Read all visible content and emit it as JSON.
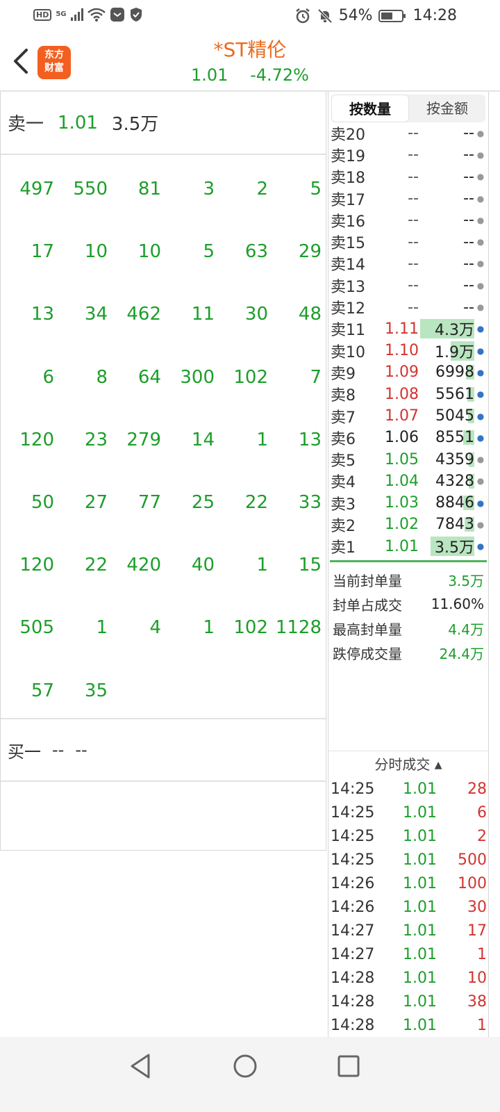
{
  "status_bar": {
    "network": "5G",
    "battery": "54%",
    "battery_level": 0.54,
    "time": "14:28",
    "icons": [
      "hd-icon",
      "signal-icon",
      "wifi-icon",
      "app-notification-icon",
      "shield-icon",
      "alarm-icon",
      "mute-icon",
      "battery-icon"
    ]
  },
  "header": {
    "logo_text": "东方财富",
    "logo_line1": "东方",
    "logo_line2": "财富",
    "title": "*ST精伦",
    "price": "1.01",
    "change": "-4.72%"
  },
  "left": {
    "sell1_label": "卖一",
    "sell1_price": "1.01",
    "sell1_volume": "3.5万",
    "queue": [
      [
        "497",
        "550",
        "81",
        "3",
        "2",
        "5"
      ],
      [
        "17",
        "10",
        "10",
        "5",
        "63",
        "29"
      ],
      [
        "13",
        "34",
        "462",
        "11",
        "30",
        "48"
      ],
      [
        "6",
        "8",
        "64",
        "300",
        "102",
        "7"
      ],
      [
        "120",
        "23",
        "279",
        "14",
        "1",
        "13"
      ],
      [
        "50",
        "27",
        "77",
        "25",
        "22",
        "33"
      ],
      [
        "120",
        "22",
        "420",
        "40",
        "1",
        "15"
      ],
      [
        "505",
        "1",
        "4",
        "1",
        "102",
        "1128"
      ],
      [
        "57",
        "35",
        "",
        "",
        "",
        ""
      ]
    ],
    "buy1_label": "买一",
    "buy1_price": "--",
    "buy1_volume": "--"
  },
  "right": {
    "tabs": [
      {
        "label": "按数量",
        "active": true
      },
      {
        "label": "按金额",
        "active": false
      }
    ],
    "orderbook": [
      {
        "label": "卖20",
        "price": "--",
        "volume": "--",
        "dot": "grey",
        "price_color": "dash",
        "bar": 0
      },
      {
        "label": "卖19",
        "price": "--",
        "volume": "--",
        "dot": "grey",
        "price_color": "dash",
        "bar": 0
      },
      {
        "label": "卖18",
        "price": "--",
        "volume": "--",
        "dot": "grey",
        "price_color": "dash",
        "bar": 0
      },
      {
        "label": "卖17",
        "price": "--",
        "volume": "--",
        "dot": "grey",
        "price_color": "dash",
        "bar": 0
      },
      {
        "label": "卖16",
        "price": "--",
        "volume": "--",
        "dot": "grey",
        "price_color": "dash",
        "bar": 0
      },
      {
        "label": "卖15",
        "price": "--",
        "volume": "--",
        "dot": "grey",
        "price_color": "dash",
        "bar": 0
      },
      {
        "label": "卖14",
        "price": "--",
        "volume": "--",
        "dot": "grey",
        "price_color": "dash",
        "bar": 0
      },
      {
        "label": "卖13",
        "price": "--",
        "volume": "--",
        "dot": "grey",
        "price_color": "dash",
        "bar": 0
      },
      {
        "label": "卖12",
        "price": "--",
        "volume": "--",
        "dot": "grey",
        "price_color": "dash",
        "bar": 0
      },
      {
        "label": "卖11",
        "price": "1.11",
        "volume": "4.3万",
        "dot": "blue",
        "price_color": "red",
        "bar": 1.0
      },
      {
        "label": "卖10",
        "price": "1.10",
        "volume": "1.9万",
        "dot": "blue",
        "price_color": "red",
        "bar": 0.44
      },
      {
        "label": "卖9",
        "price": "1.09",
        "volume": "6998",
        "dot": "blue",
        "price_color": "red",
        "bar": 0.16
      },
      {
        "label": "卖8",
        "price": "1.08",
        "volume": "5561",
        "dot": "blue",
        "price_color": "red",
        "bar": 0.13
      },
      {
        "label": "卖7",
        "price": "1.07",
        "volume": "5045",
        "dot": "blue",
        "price_color": "red",
        "bar": 0.12
      },
      {
        "label": "卖6",
        "price": "1.06",
        "volume": "8551",
        "dot": "blue",
        "price_color": "black",
        "bar": 0.2
      },
      {
        "label": "卖5",
        "price": "1.05",
        "volume": "4359",
        "dot": "grey",
        "price_color": "green",
        "bar": 0.1
      },
      {
        "label": "卖4",
        "price": "1.04",
        "volume": "4328",
        "dot": "grey",
        "price_color": "green",
        "bar": 0.1
      },
      {
        "label": "卖3",
        "price": "1.03",
        "volume": "8846",
        "dot": "blue",
        "price_color": "green",
        "bar": 0.21
      },
      {
        "label": "卖2",
        "price": "1.02",
        "volume": "7843",
        "dot": "grey",
        "price_color": "green",
        "bar": 0.18
      },
      {
        "label": "卖1",
        "price": "1.01",
        "volume": "3.5万",
        "dot": "blue",
        "price_color": "green",
        "bar": 0.81
      }
    ],
    "stats": [
      {
        "key": "当前封单量",
        "value": "3.5万",
        "tone": "green"
      },
      {
        "key": "封单占成交",
        "value": "11.60%",
        "tone": "dark"
      },
      {
        "key": "最高封单量",
        "value": "4.4万",
        "tone": "green"
      },
      {
        "key": "跌停成交量",
        "value": "24.4万",
        "tone": "green"
      }
    ],
    "ticks_title": "分时成交",
    "ticks": [
      {
        "time": "14:25",
        "price": "1.01",
        "qty": "28"
      },
      {
        "time": "14:25",
        "price": "1.01",
        "qty": "6"
      },
      {
        "time": "14:25",
        "price": "1.01",
        "qty": "2"
      },
      {
        "time": "14:25",
        "price": "1.01",
        "qty": "500"
      },
      {
        "time": "14:26",
        "price": "1.01",
        "qty": "100"
      },
      {
        "time": "14:26",
        "price": "1.01",
        "qty": "30"
      },
      {
        "time": "14:27",
        "price": "1.01",
        "qty": "17"
      },
      {
        "time": "14:27",
        "price": "1.01",
        "qty": "1"
      },
      {
        "time": "14:28",
        "price": "1.01",
        "qty": "10"
      },
      {
        "time": "14:28",
        "price": "1.01",
        "qty": "38"
      },
      {
        "time": "14:28",
        "price": "1.01",
        "qty": "1"
      }
    ]
  },
  "colors": {
    "green": "#1c9e2a",
    "red": "#d2342f",
    "brand": "#f35f1f",
    "title": "#ea6b1e",
    "bar": "#b9e5c0",
    "dot_blue": "#3474c6"
  }
}
